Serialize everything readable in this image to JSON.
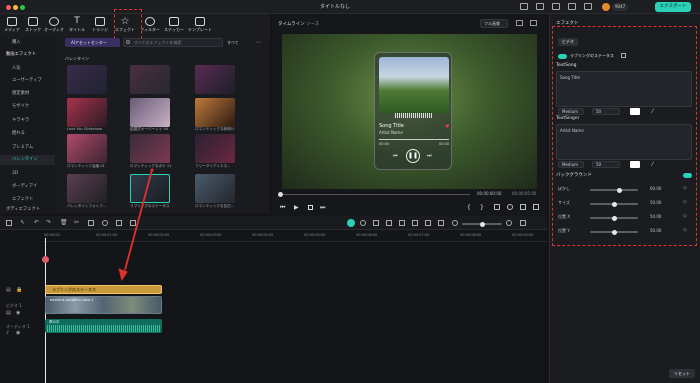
{
  "window": {
    "title": "タイトルなし",
    "export_label": "エクスポート",
    "credits": "9047"
  },
  "toolbar": {
    "items": [
      "メディア",
      "ストック",
      "オーディオ",
      "タイトル",
      "トランジ",
      "エフェクト",
      "フィルター",
      "ステッカー",
      "テンプレート"
    ]
  },
  "sidebar": {
    "items": [
      "購入",
      "動画エフェクト",
      "人気",
      "ユーザーティブ",
      "限定素材",
      "モザイク",
      "キラキラ",
      "揺れる",
      "プレミアム",
      "バレンタイン",
      "3D",
      "ボーディアイ",
      "エフェクト",
      "ボディエフェクト"
    ]
  },
  "assets": {
    "ai_button": "AIアセットセンター",
    "search_placeholder": "すべてのエフェクトを検索",
    "filter_label": "すべて",
    "section_title": "バレンタイン",
    "items": [
      "",
      "",
      "",
      "Love You Slideshow",
      "結婚式オーバーレイ 04",
      "ロマンティックな夜明け",
      "ロマンティック会議 01",
      "ロマンティックなボケ 11",
      "フリーダイアイエネ...",
      "バレンタインフォトフ...",
      "ラブリングのステータス",
      "ロマンティックな告白...",
      "愛のムードが溢れる",
      "記念日を祝う愛の記念日",
      "ロマンティック装飾 01"
    ]
  },
  "preview": {
    "tab_timeline": "タイムライン",
    "tab_source": "ソース",
    "quality": "フル画質",
    "song_title": "Song Title",
    "artist_name": "Artist Name",
    "time_start": "00:00",
    "time_end": "00:00",
    "current_time": "00:00:00:00",
    "total_time": "00:00:05:00"
  },
  "props": {
    "header": "エフェクト",
    "tab_video": "ビデオ",
    "effect_name": "ラブリングのステータス",
    "textsong_label": "TextSong",
    "textsong_value": "Song Title",
    "font1": "Medium",
    "size1": "50",
    "textsinger_label": "TextSinger",
    "textsinger_value": "Artist Name",
    "font2": "Medium",
    "size2": "50",
    "background_label": "バックグラウンド",
    "sliders": [
      {
        "label": "ぼかし",
        "value": "60.00",
        "level": 0.6
      },
      {
        "label": "サイズ",
        "value": "50.00",
        "level": 0.5
      },
      {
        "label": "位置 X",
        "value": "50.00",
        "level": 0.5
      },
      {
        "label": "位置 Y",
        "value": "50.00",
        "level": 0.5
      }
    ],
    "reset_label": "リセット"
  },
  "timeline": {
    "ruler": [
      "00:00:00",
      "00:00:01:00",
      "00:00:02:00",
      "00:00:03:00",
      "00:00:04:00",
      "00:00:05:00",
      "00:00:06:00",
      "00:00:07:00",
      "00:00:08:00",
      "00:00:09:00",
      "00:00:10:00"
    ],
    "effect_clip": "ラブリングのステータス",
    "video_clip": "mixkit-a-couple-in-love-1",
    "audio_clip": "夢の中",
    "video_track_label": "ビデオ 1",
    "audio_track_label": "オーディオ 1"
  },
  "colors": {
    "accent": "#2ad1b7",
    "highlight": "#e0322b",
    "clip_effect": "#c89a3a",
    "clip_audio": "#0f6b5a"
  }
}
